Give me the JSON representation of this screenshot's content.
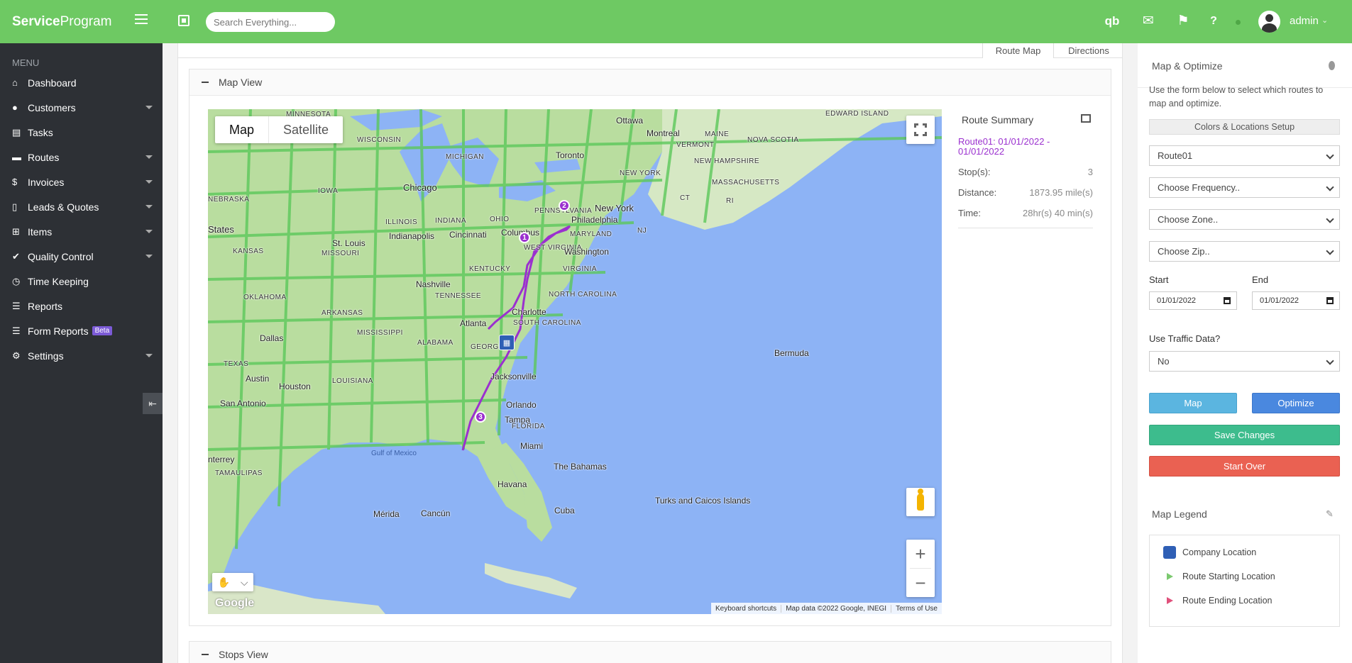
{
  "app": {
    "brand_bold": "Service",
    "brand_rest": "Program"
  },
  "topbar": {
    "search_placeholder": "Search Everything...",
    "icons": [
      "quickbooks-icon",
      "envelope-icon",
      "flag-icon",
      "help-icon"
    ],
    "user_name": "admin"
  },
  "sidebar": {
    "menu_label": "MENU",
    "items": [
      {
        "label": "Dashboard",
        "icon": "home-icon",
        "glyph": "⌂",
        "caret": false
      },
      {
        "label": "Customers",
        "icon": "user-icon",
        "glyph": "●",
        "caret": true
      },
      {
        "label": "Tasks",
        "icon": "clipboard-icon",
        "glyph": "▤",
        "caret": false
      },
      {
        "label": "Routes",
        "icon": "truck-icon",
        "glyph": "▬",
        "caret": true
      },
      {
        "label": "Invoices",
        "icon": "dollar-icon",
        "glyph": "$",
        "caret": true
      },
      {
        "label": "Leads & Quotes",
        "icon": "file-icon",
        "glyph": "▯",
        "caret": true
      },
      {
        "label": "Items",
        "icon": "cart-icon",
        "glyph": "⊞",
        "caret": true
      },
      {
        "label": "Quality Control",
        "icon": "user-check-icon",
        "glyph": "✔",
        "caret": true
      },
      {
        "label": "Time Keeping",
        "icon": "clock-icon",
        "glyph": "◷",
        "caret": false
      },
      {
        "label": "Reports",
        "icon": "list-icon",
        "glyph": "☰",
        "caret": false
      },
      {
        "label": "Form Reports",
        "icon": "form-icon",
        "glyph": "☰",
        "caret": false,
        "badge": "Beta"
      },
      {
        "label": "Settings",
        "icon": "gear-icon",
        "glyph": "⚙",
        "caret": true
      }
    ]
  },
  "tabs": {
    "route_map": "Route Map",
    "directions": "Directions"
  },
  "panels": {
    "map_view": "Map View",
    "stops_view": "Stops View"
  },
  "map": {
    "type_map": "Map",
    "type_satellite": "Satellite",
    "attribution": [
      "Keyboard shortcuts",
      "Map data ©2022 Google, INEGI",
      "Terms of Use"
    ],
    "labels": [
      "MINNESOTA",
      "WISCONSIN",
      "MICHIGAN",
      "Ottawa",
      "Montreal",
      "EDWARD ISLAND",
      "MAINE",
      "NOVA SCOTIA",
      "Toronto",
      "VERMONT",
      "NEW HAMPSHIRE",
      "MASSACHUSETTS",
      "NEW YORK",
      "CT",
      "RI",
      "IOWA",
      "Chicago",
      "NEBRASKA",
      "States",
      "ILLINOIS",
      "INDIANA",
      "OHIO",
      "PENNSYLVANIA",
      "New York",
      "NJ",
      "Philadelphia",
      "Indianapolis",
      "Cincinnati",
      "Columbus",
      "MARYLAND",
      "KANSAS",
      "St. Louis",
      "MISSOURI",
      "WEST VIRGINIA",
      "Washington",
      "KENTUCKY",
      "VIRGINIA",
      "Nashville",
      "TENNESSEE",
      "OKLAHOMA",
      "NORTH CAROLINA",
      "ARKANSAS",
      "Charlotte",
      "Atlanta",
      "SOUTH CAROLINA",
      "MISSISSIPPI",
      "ALABAMA",
      "Dallas",
      "GEORGIA",
      "Bermuda",
      "TEXAS",
      "LOUISIANA",
      "Jacksonville",
      "Austin",
      "Houston",
      "San Antonio",
      "Orlando",
      "Tampa",
      "FLORIDA",
      "Gulf of Mexico",
      "Miami",
      "nterrey",
      "TAMAULIPAS",
      "The Bahamas",
      "Havana",
      "Mérida",
      "Cancún",
      "Cuba",
      "Turks and Caicos Islands"
    ],
    "stops": [
      "1",
      "2",
      "3"
    ]
  },
  "summary": {
    "title": "Route Summary",
    "route": "Route01: 01/01/2022 - 01/01/2022",
    "stops_label": "Stop(s):",
    "stops_value": "3",
    "distance_label": "Distance:",
    "distance_value": "1873.95 mile(s)",
    "time_label": "Time:",
    "time_value": "28hr(s) 40 min(s)"
  },
  "right": {
    "title": "Map & Optimize",
    "desc": "Use the form below to select which routes to map and optimize.",
    "setup_button": "Colors & Locations Setup",
    "route_select": "Route01",
    "frequency_select": "Choose Frequency..",
    "zone_select": "Choose Zone..",
    "zip_select": "Choose Zip..",
    "start_label": "Start",
    "start_value": "01/01/2022",
    "end_label": "End",
    "end_value": "01/01/2022",
    "traffic_label": "Use Traffic Data?",
    "traffic_value": "No",
    "map_button": "Map",
    "optimize_button": "Optimize",
    "save_button": "Save Changes",
    "start_over_button": "Start Over",
    "legend_title": "Map Legend",
    "legend": [
      "Company Location",
      "Route Starting Location",
      "Route Ending Location"
    ]
  },
  "colors": {
    "accent_green": "#6ec963",
    "sidebar": "#2d3035",
    "route_purple": "#9b30cf",
    "water": "#8db3f5"
  }
}
